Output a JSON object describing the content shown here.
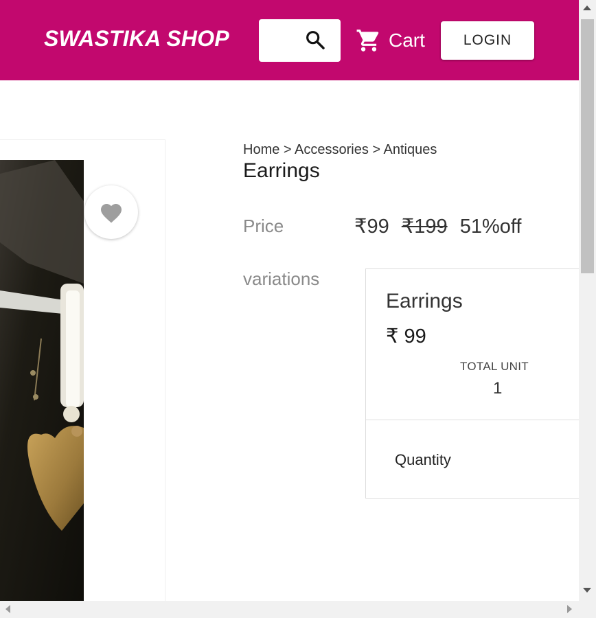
{
  "header": {
    "brand": "SWASTIKA SHOP",
    "search_icon": "search-icon",
    "cart_icon": "cart-icon",
    "cart_label": "Cart",
    "login_label": "LOGIN",
    "bg_color": "#c2086e"
  },
  "product": {
    "breadcrumb": "Home > Accessories > Antiques",
    "title": "Earrings",
    "price_label": "Price",
    "price_current": "₹99",
    "price_original": "₹199",
    "discount": "51%off",
    "variations_label": "variations",
    "wishlist_icon": "heart-icon"
  },
  "variation": {
    "name": "Earrings",
    "price": "₹ 99",
    "total_unit_label": "TOTAL UNIT",
    "total_unit_value": "1",
    "quantity_label": "Quantity"
  }
}
